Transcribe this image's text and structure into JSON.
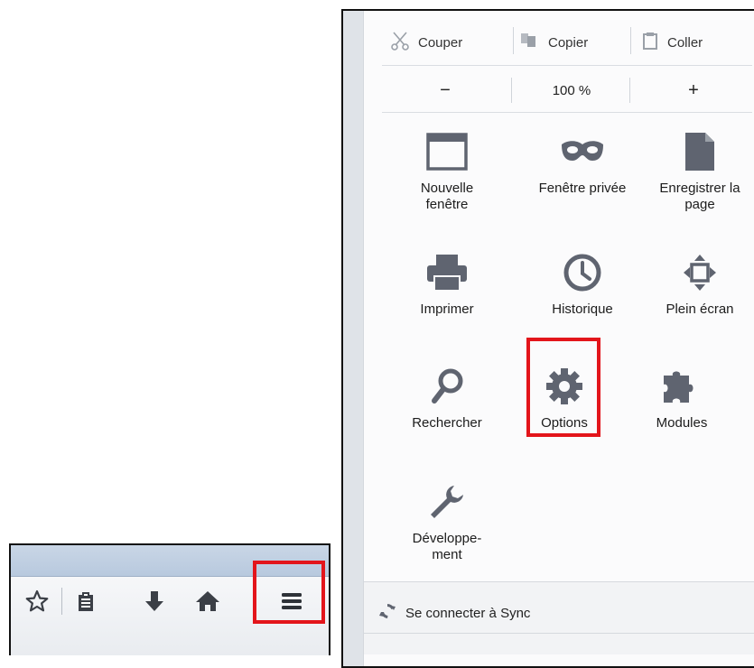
{
  "toolbar": {
    "icons": [
      "star-icon",
      "reading-list-icon",
      "download-icon",
      "home-icon",
      "menu-icon"
    ]
  },
  "panel": {
    "edit": {
      "cut": "Couper",
      "copy": "Copier",
      "paste": "Coller"
    },
    "zoom": {
      "minus": "−",
      "level": "100 %",
      "plus": "+"
    },
    "items": [
      {
        "label": "Nouvelle fenêtre",
        "icon": "new-window-icon"
      },
      {
        "label": "Fenêtre privée",
        "icon": "private-mask-icon"
      },
      {
        "label": "Enregistrer la page",
        "icon": "save-page-icon"
      },
      {
        "label": "Imprimer",
        "icon": "printer-icon"
      },
      {
        "label": "Historique",
        "icon": "history-clock-icon"
      },
      {
        "label": "Plein écran",
        "icon": "fullscreen-icon"
      },
      {
        "label": "Rechercher",
        "icon": "search-icon"
      },
      {
        "label": "Options",
        "icon": "gear-icon"
      },
      {
        "label": "Modules",
        "icon": "puzzle-icon"
      },
      {
        "label": "Développe-\nment",
        "icon": "wrench-icon"
      }
    ],
    "sync": "Se connecter à Sync"
  },
  "colors": {
    "highlight": "#e3151b",
    "icon": "#5f6470"
  }
}
